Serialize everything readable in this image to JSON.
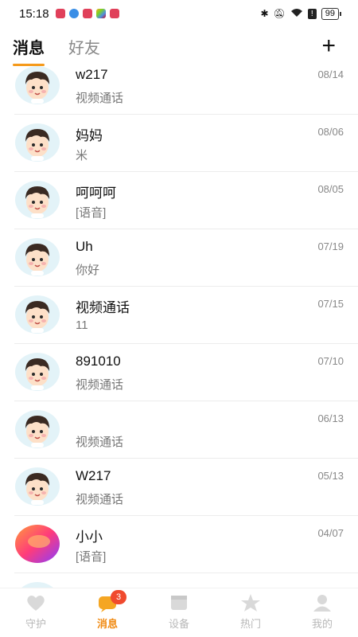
{
  "status": {
    "time": "15:18",
    "battery": "99"
  },
  "header": {
    "tabs": [
      {
        "label": "消息"
      },
      {
        "label": "好友"
      }
    ],
    "add_label": "+"
  },
  "conversations": [
    {
      "name": "w217",
      "preview": "视频通话",
      "date": "08/14"
    },
    {
      "name": "妈妈",
      "preview": "米",
      "date": "08/06"
    },
    {
      "name": "呵呵呵",
      "preview": "[语音]",
      "date": "08/05"
    },
    {
      "name": "Uh",
      "preview": "你好",
      "date": "07/19"
    },
    {
      "name": "视频通话",
      "preview": "11",
      "date": "07/15"
    },
    {
      "name": "891010",
      "preview": "视频通话",
      "date": "07/10"
    },
    {
      "name": "",
      "preview": "视频通话",
      "date": "06/13"
    },
    {
      "name": "W217",
      "preview": "视频通话",
      "date": "05/13"
    },
    {
      "name": "小小",
      "preview": "[语音]",
      "date": "04/07"
    },
    {
      "name": "",
      "preview": "",
      "date": ""
    }
  ],
  "nav": {
    "items": [
      {
        "label": "守护",
        "icon": "heart-icon"
      },
      {
        "label": "消息",
        "icon": "message-icon",
        "badge": "3"
      },
      {
        "label": "设备",
        "icon": "device-icon"
      },
      {
        "label": "热门",
        "icon": "star-icon"
      },
      {
        "label": "我的",
        "icon": "profile-icon"
      }
    ]
  },
  "colors": {
    "accent": "#f59a1b",
    "badge": "#f04a2e"
  }
}
